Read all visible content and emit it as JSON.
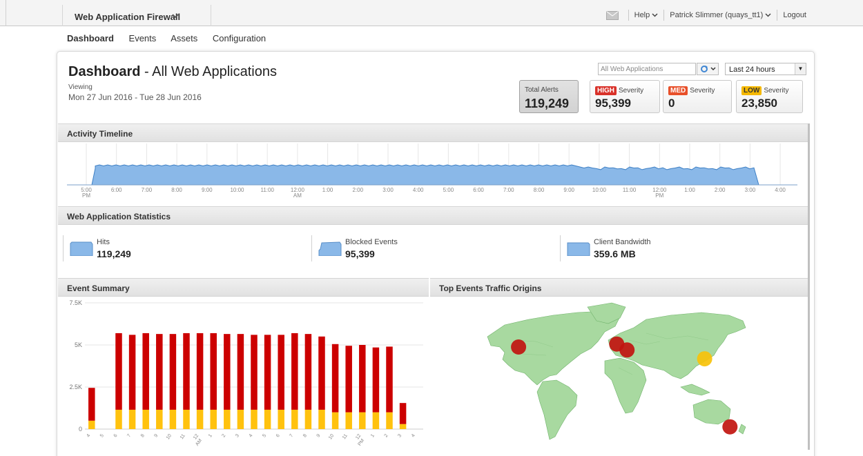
{
  "app": {
    "name": "Web Application Firewall"
  },
  "utility": {
    "help": "Help",
    "user": "Patrick Slimmer (quays_tt1)",
    "logout": "Logout"
  },
  "nav": [
    "Dashboard",
    "Events",
    "Assets",
    "Configuration"
  ],
  "header": {
    "title_bold": "Dashboard",
    "title_rest": " - All Web Applications",
    "viewing_label": "Viewing",
    "date_range": "Mon 27 Jun 2016 - Tue 28 Jun 2016"
  },
  "filters": {
    "web_app": "All Web Applications",
    "time_range": "Last 24 hours"
  },
  "alerts": {
    "total_label": "Total Alerts",
    "total": "119,249",
    "severity_word": "Severity",
    "high_badge": "HIGH",
    "high": "95,399",
    "med_badge": "MED",
    "med": "0",
    "low_badge": "LOW",
    "low": "23,850"
  },
  "colors": {
    "high": "#d9322a",
    "med": "#e8502a",
    "low": "#f5b800",
    "area": "#8ab8e8",
    "area_line": "#3d7fc4",
    "bar_high": "#cc0000",
    "bar_low": "#ffc20e",
    "map_land": "#a8d9a0",
    "map_dot_red": "#c1150f",
    "map_dot_yellow": "#f7c20a"
  },
  "sections": {
    "activity": "Activity Timeline",
    "stats": "Web Application Statistics",
    "events": "Event Summary",
    "origins": "Top Events Traffic Origins"
  },
  "timeline": {
    "ticks": [
      {
        "t": "5:00",
        "s": "PM"
      },
      {
        "t": "6:00",
        "s": ""
      },
      {
        "t": "7:00",
        "s": ""
      },
      {
        "t": "8:00",
        "s": ""
      },
      {
        "t": "9:00",
        "s": ""
      },
      {
        "t": "10:00",
        "s": ""
      },
      {
        "t": "11:00",
        "s": ""
      },
      {
        "t": "12:00",
        "s": "AM"
      },
      {
        "t": "1:00",
        "s": ""
      },
      {
        "t": "2:00",
        "s": ""
      },
      {
        "t": "3:00",
        "s": ""
      },
      {
        "t": "4:00",
        "s": ""
      },
      {
        "t": "5:00",
        "s": ""
      },
      {
        "t": "6:00",
        "s": ""
      },
      {
        "t": "7:00",
        "s": ""
      },
      {
        "t": "8:00",
        "s": ""
      },
      {
        "t": "9:00",
        "s": ""
      },
      {
        "t": "10:00",
        "s": ""
      },
      {
        "t": "11:00",
        "s": ""
      },
      {
        "t": "12:00",
        "s": "PM"
      },
      {
        "t": "1:00",
        "s": ""
      },
      {
        "t": "2:00",
        "s": ""
      },
      {
        "t": "3:00",
        "s": ""
      },
      {
        "t": "4:00",
        "s": ""
      }
    ]
  },
  "stats": [
    {
      "label": "Hits",
      "value": "119,249"
    },
    {
      "label": "Blocked Events",
      "value": "95,399"
    },
    {
      "label": "Client Bandwidth",
      "value": "359.6 MB"
    }
  ],
  "chart_data": {
    "type": "bar",
    "title": "Event Summary",
    "stacked": true,
    "ylim": [
      0,
      7500
    ],
    "yticks": [
      "7.5K",
      "5K",
      "2.5K",
      "0"
    ],
    "ytick_values": [
      7500,
      5000,
      2500,
      0
    ],
    "categories": [
      "4",
      "5",
      "6",
      "7",
      "8",
      "9",
      "10",
      "11",
      "12 AM",
      "1",
      "2",
      "3",
      "4",
      "5",
      "6",
      "7",
      "8",
      "9",
      "10",
      "11",
      "12 PM",
      "1",
      "2",
      "3",
      "4"
    ],
    "series": [
      {
        "name": "LOW",
        "color": "#ffc20e",
        "values": [
          500,
          0,
          1150,
          1150,
          1150,
          1150,
          1150,
          1150,
          1150,
          1150,
          1150,
          1150,
          1150,
          1150,
          1150,
          1150,
          1150,
          1150,
          1000,
          1000,
          1000,
          1000,
          1000,
          300,
          0
        ]
      },
      {
        "name": "HIGH",
        "color": "#cc0000",
        "values": [
          1950,
          0,
          4550,
          4450,
          4550,
          4500,
          4500,
          4550,
          4550,
          4550,
          4500,
          4500,
          4450,
          4450,
          4450,
          4550,
          4500,
          4350,
          4050,
          3950,
          4000,
          3850,
          3900,
          1250,
          0
        ]
      }
    ]
  },
  "map_data": {
    "origins": [
      {
        "name": "USA (Northwest)",
        "severity": "high",
        "lon": -122,
        "lat": 45
      },
      {
        "name": "Western Europe",
        "severity": "high",
        "lon": 2,
        "lat": 48
      },
      {
        "name": "Central Europe",
        "severity": "high",
        "lon": 15,
        "lat": 42
      },
      {
        "name": "China",
        "severity": "low",
        "lon": 113,
        "lat": 33
      },
      {
        "name": "Australia",
        "severity": "high",
        "lon": 145,
        "lat": -36
      }
    ]
  }
}
